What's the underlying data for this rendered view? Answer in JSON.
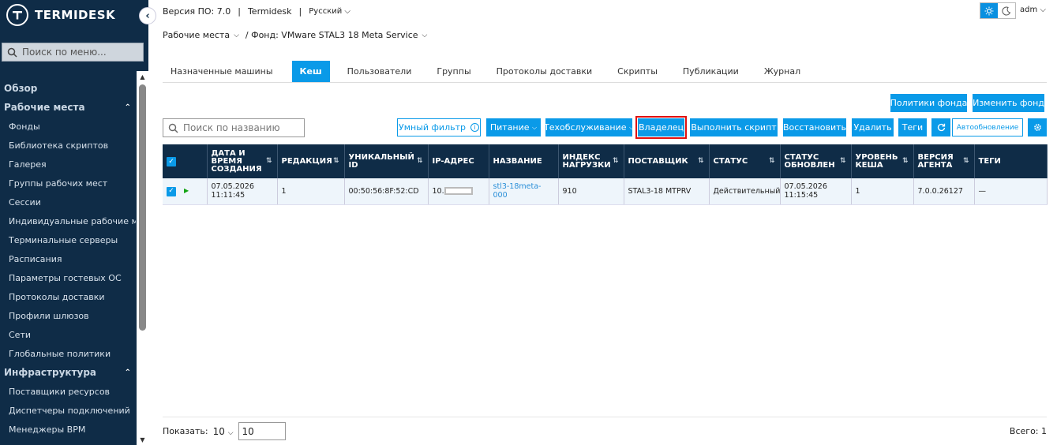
{
  "app": {
    "brand": "TERMIDESK",
    "accent": "#0a9ae8",
    "sidebar_bg": "#0f2c47"
  },
  "sidebar": {
    "search_placeholder": "Поиск по меню...",
    "sections": [
      {
        "label": "Обзор",
        "chevron": "",
        "items": []
      },
      {
        "label": "Рабочие места",
        "chevron": "^",
        "items": [
          "Фонды",
          "Библиотека скриптов",
          "Галерея",
          "Группы рабочих мест",
          "Сессии",
          "Индивидуальные рабочие места",
          "Терминальные серверы",
          "Расписания",
          "Параметры гостевых ОС",
          "Протоколы доставки",
          "Профили шлюзов",
          "Сети",
          "Глобальные политики"
        ]
      },
      {
        "label": "Инфраструктура",
        "chevron": "^",
        "items": [
          "Поставщики ресурсов",
          "Диспетчеры подключений",
          "Менеджеры ВРМ"
        ]
      }
    ]
  },
  "topbar": {
    "version": "Версия ПО: 7.0",
    "product": "Termidesk",
    "language": "Русский",
    "user": "adm"
  },
  "breadcrumb": {
    "root": "Рабочие места",
    "current": "Фонд: VMware STAL3 18 Meta Service"
  },
  "tabs": [
    "Назначенные машины",
    "Кеш",
    "Пользователи",
    "Группы",
    "Протоколы доставки",
    "Скрипты",
    "Публикации",
    "Журнал"
  ],
  "active_tab": "Кеш",
  "actions": {
    "pool_policies": "Политики фонда",
    "edit_pool": "Изменить фонд",
    "smart_filter": "Умный фильтр",
    "power": "Питание",
    "maintenance": "Техобслуживание",
    "owner": "Владелец",
    "run_script": "Выполнить скрипт",
    "restore": "Восстановить",
    "delete": "Удалить",
    "tags": "Теги",
    "auto_refresh": "Автообновление"
  },
  "search": {
    "placeholder": "Поиск по названию"
  },
  "table": {
    "headers": [
      "ДАТА И ВРЕМЯ СОЗДАНИЯ",
      "РЕДАКЦИЯ",
      "УНИКАЛЬНЫЙ ID",
      "IP-АДРЕС",
      "НАЗВАНИЕ",
      "ИНДЕКС НАГРУЗКИ",
      "ПОСТАВЩИК",
      "СТАТУС",
      "СТАТУС ОБНОВЛЕН",
      "УРОВЕНЬ КЕША",
      "ВЕРСИЯ АГЕНТА",
      "ТЕГИ"
    ],
    "rows": [
      {
        "created_date": "07.05.2026",
        "created_time": "11:11:45",
        "revision": "1",
        "uid": "00:50:56:8F:52:CD",
        "ip_prefix": "10.",
        "name": "stl3-18meta-000",
        "load_index": "910",
        "provider": "STAL3-18 MTPRV",
        "status": "Действительный",
        "status_date": "07.05.2026",
        "status_time": "11:15:45",
        "cache_level": "1",
        "agent_version": "7.0.0.26127",
        "tags": "—"
      }
    ]
  },
  "footer": {
    "show_label": "Показать:",
    "page_size": "10",
    "page_input": "10",
    "total": "Всего: 1"
  }
}
